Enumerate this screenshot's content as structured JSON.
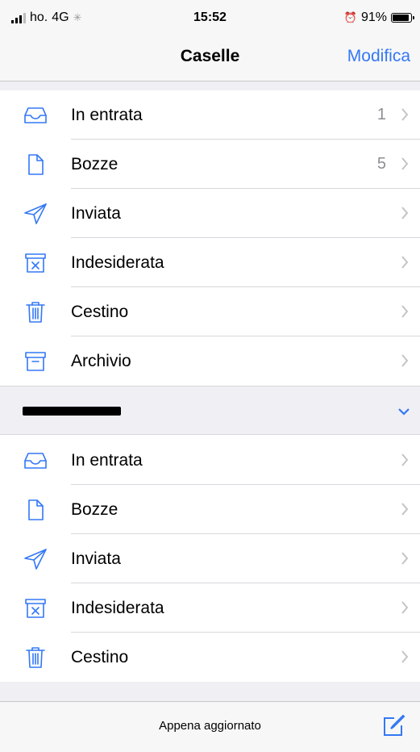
{
  "status_bar": {
    "carrier": "ho.",
    "network": "4G",
    "time": "15:52",
    "battery": "91%"
  },
  "nav": {
    "title": "Caselle",
    "edit_label": "Modifica"
  },
  "mailboxes": [
    {
      "label": "In entrata",
      "count": "1",
      "icon": "inbox-icon"
    },
    {
      "label": "Bozze",
      "count": "5",
      "icon": "draft-icon"
    },
    {
      "label": "Inviata",
      "count": "",
      "icon": "sent-icon"
    },
    {
      "label": "Indesiderata",
      "count": "",
      "icon": "junk-icon"
    },
    {
      "label": "Cestino",
      "count": "",
      "icon": "trash-icon"
    },
    {
      "label": "Archivio",
      "count": "",
      "icon": "archive-icon"
    }
  ],
  "account_mailboxes": [
    {
      "label": "In entrata",
      "icon": "inbox-icon"
    },
    {
      "label": "Bozze",
      "icon": "draft-icon"
    },
    {
      "label": "Inviata",
      "icon": "sent-icon"
    },
    {
      "label": "Indesiderata",
      "icon": "junk-icon"
    },
    {
      "label": "Cestino",
      "icon": "trash-icon"
    }
  ],
  "toolbar": {
    "status": "Appena aggiornato"
  },
  "colors": {
    "accent": "#3478f6",
    "background": "#efeff4",
    "separator": "#d8d8dc"
  }
}
